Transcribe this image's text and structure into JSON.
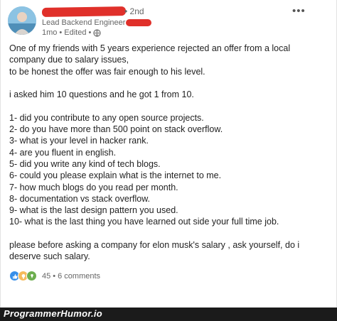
{
  "post": {
    "author": {
      "degree": "• 2nd",
      "headline": "Lead Backend Engineer at",
      "time": "1mo",
      "edited": "Edited"
    },
    "more_label": "•••",
    "body_lines": [
      "One of my friends with 5 years experience rejected an offer from a local",
      "company due to salary issues,",
      "to be honest the offer was fair enough to his level.",
      "",
      "i asked him 10 questions and he got 1 from 10.",
      "",
      "1- did you contribute to any open source projects.",
      "2- do you have more than 500 point on stack overflow.",
      "3- what is your level in hacker rank.",
      "4- are you fluent in english.",
      "5- did you write any kind of tech blogs.",
      "6- could you please explain what is the internet to me.",
      "7- how much blogs do you read per month.",
      "8- documentation vs stack overflow.",
      "9- what is the last design pattern you used.",
      "10- what is the last thing you have learned out side your full time job.",
      "",
      "please before asking a company for elon musk's salary , ask yourself, do i",
      "deserve such salary."
    ],
    "reactions": {
      "count": "45",
      "separator": "•",
      "comments": "6 comments"
    }
  },
  "watermark": "ProgrammerHumor.io",
  "colors": {
    "redaction": "#e0302a",
    "like": "#378fe9",
    "insight": "#f5bb5c",
    "celebrate": "#6dae4f"
  }
}
